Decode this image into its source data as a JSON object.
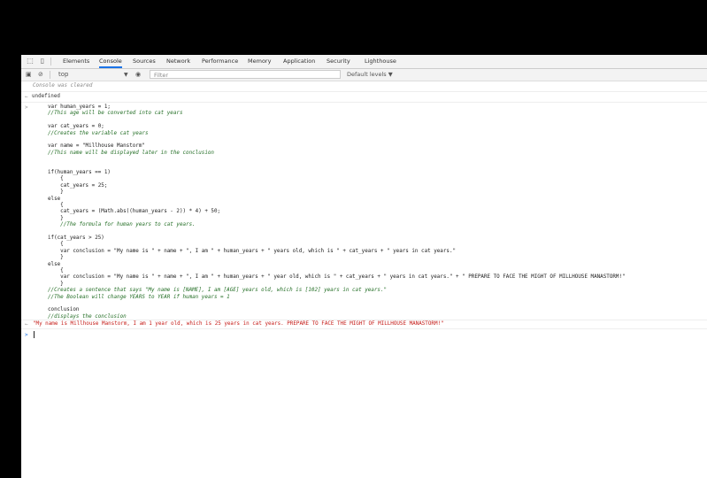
{
  "tabs": [
    "Elements",
    "Console",
    "Sources",
    "Network",
    "Performance",
    "Memory",
    "Application",
    "Security",
    "Lighthouse"
  ],
  "active_tab": "Console",
  "toolbar": {
    "context": "top",
    "filter_placeholder": "Filter",
    "levels": "Default levels ▼"
  },
  "console": {
    "cleared": "Console was cleared",
    "undefined": "undefined",
    "code": [
      {
        "t": "var human_years = 1;",
        "cls": "p"
      },
      {
        "t": "//This age will be converted into cat years",
        "cls": "c"
      },
      {
        "t": "",
        "cls": "p"
      },
      {
        "t": "var cat_years = 0;",
        "cls": "p"
      },
      {
        "t": "//Creates the variable cat years",
        "cls": "c"
      },
      {
        "t": "",
        "cls": "p"
      },
      {
        "t": "var name = \"Millhouse Manstorm\"",
        "cls": "p"
      },
      {
        "t": "//This name will be displayed later in the conclusion",
        "cls": "c"
      },
      {
        "t": "",
        "cls": "p"
      },
      {
        "t": "",
        "cls": "p"
      },
      {
        "t": "if(human_years == 1)",
        "cls": "p"
      },
      {
        "t": "    {",
        "cls": "p"
      },
      {
        "t": "    cat_years = 25;",
        "cls": "p"
      },
      {
        "t": "    }",
        "cls": "p"
      },
      {
        "t": "else",
        "cls": "p"
      },
      {
        "t": "    {",
        "cls": "p"
      },
      {
        "t": "    cat_years = (Math.abs((human_years - 2)) * 4) + 50;",
        "cls": "p"
      },
      {
        "t": "    }",
        "cls": "p"
      },
      {
        "t": "    //The formula for human years to cat years.",
        "cls": "c"
      },
      {
        "t": "",
        "cls": "p"
      },
      {
        "t": "if(cat_years > 25)",
        "cls": "p"
      },
      {
        "t": "    {",
        "cls": "p"
      },
      {
        "t": "    var conclusion = \"My name is \" + name + \", I am \" + human_years + \" years old, which is \" + cat_years + \" years in cat years.\"",
        "cls": "p"
      },
      {
        "t": "    }",
        "cls": "p"
      },
      {
        "t": "else",
        "cls": "p"
      },
      {
        "t": "    {",
        "cls": "p"
      },
      {
        "t": "    var conclusion = \"My name is \" + name + \", I am \" + human_years + \" year old, which is \" + cat_years + \" years in cat years.\" + \" PREPARE TO FACE THE MIGHT OF MILLHOUSE MANASTORM!\"",
        "cls": "p"
      },
      {
        "t": "    }",
        "cls": "p"
      },
      {
        "t": "//Creates a sentence that says \"My name is [NAME], I am [AGE] years old, which is [102] years in cat years.\"",
        "cls": "c"
      },
      {
        "t": "//The Boolean will change YEARS to YEAR if human years = 1",
        "cls": "c"
      },
      {
        "t": "",
        "cls": "p"
      },
      {
        "t": "conclusion",
        "cls": "p"
      },
      {
        "t": "//displays the conclusion",
        "cls": "c"
      }
    ],
    "result": "\"My name is Millhouse Manstorm, I am 1 year old, which is 25 years in cat years. PREPARE TO FACE THE MIGHT OF MILLHOUSE MANASTORM!\""
  }
}
